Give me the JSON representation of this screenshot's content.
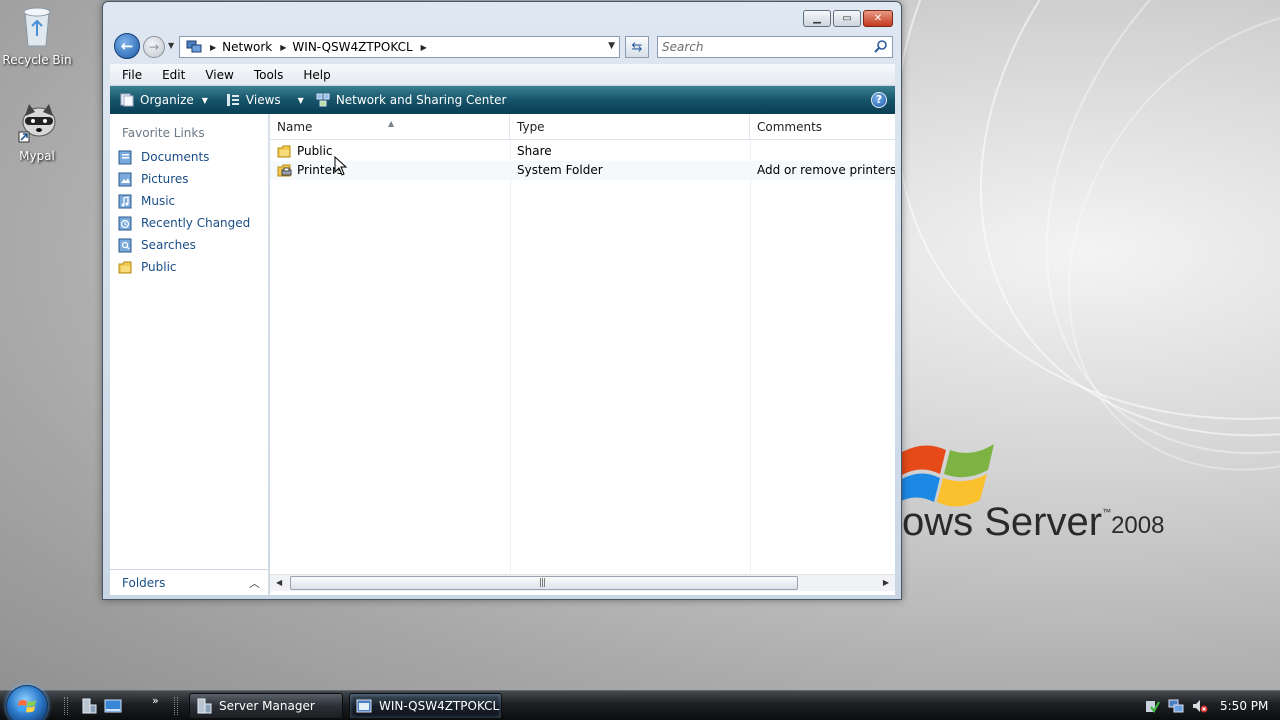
{
  "desktop": {
    "icons": [
      {
        "label": "Recycle Bin",
        "icon": "recycle-bin-icon"
      },
      {
        "label": "Mypal",
        "icon": "mypal-raccoon-icon"
      }
    ],
    "wallpaper_brand_partial": "ows Server",
    "wallpaper_brand_year": "2008",
    "wallpaper_brand_tm": "™"
  },
  "window": {
    "controls": {
      "minimize": "minimize-icon",
      "maximize": "maximize-icon",
      "close": "close-icon"
    },
    "address": {
      "root_icon": "network-icon",
      "crumbs": [
        "Network",
        "WIN-QSW4ZTPOKCL"
      ]
    },
    "search": {
      "placeholder": "Search"
    },
    "menu": [
      "File",
      "Edit",
      "View",
      "Tools",
      "Help"
    ],
    "toolbar": {
      "organize": "Organize",
      "views": "Views",
      "network_center": "Network and Sharing Center",
      "help": "?"
    },
    "nav_pane": {
      "header": "Favorite Links",
      "items": [
        {
          "label": "Documents",
          "icon": "documents-icon"
        },
        {
          "label": "Pictures",
          "icon": "pictures-icon"
        },
        {
          "label": "Music",
          "icon": "music-icon"
        },
        {
          "label": "Recently Changed",
          "icon": "recently-changed-icon"
        },
        {
          "label": "Searches",
          "icon": "searches-icon"
        },
        {
          "label": "Public",
          "icon": "public-folder-icon"
        }
      ],
      "folders_label": "Folders"
    },
    "list": {
      "columns": [
        "Name",
        "Type",
        "Comments"
      ],
      "rows": [
        {
          "name": "Public",
          "type": "Share",
          "comments": "",
          "icon": "share-folder-icon"
        },
        {
          "name": "Printers",
          "type": "System Folder",
          "comments": "Add or remove printers, vi",
          "icon": "printers-folder-icon"
        }
      ]
    }
  },
  "taskbar": {
    "tasks": [
      {
        "label": "Server Manager",
        "icon": "server-manager-icon",
        "active": false
      },
      {
        "label": "WIN-QSW4ZTPOKCL",
        "icon": "explorer-window-icon",
        "active": true
      }
    ],
    "more": "»",
    "clock": "5:50 PM"
  },
  "colors": {
    "toolbar_teal": "#16546a",
    "link_blue": "#1a4d86",
    "close_red": "#c3391c"
  }
}
